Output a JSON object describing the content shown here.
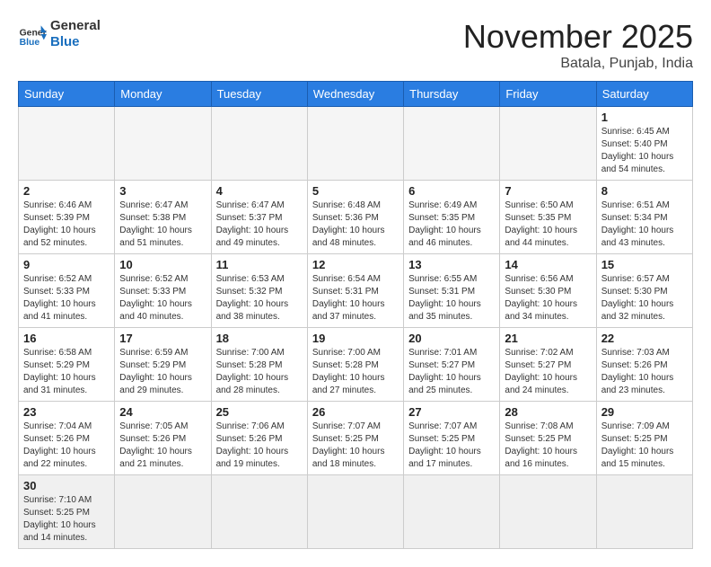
{
  "header": {
    "logo_general": "General",
    "logo_blue": "Blue",
    "month_title": "November 2025",
    "location": "Batala, Punjab, India"
  },
  "weekdays": [
    "Sunday",
    "Monday",
    "Tuesday",
    "Wednesday",
    "Thursday",
    "Friday",
    "Saturday"
  ],
  "weeks": [
    [
      {
        "day": "",
        "info": ""
      },
      {
        "day": "",
        "info": ""
      },
      {
        "day": "",
        "info": ""
      },
      {
        "day": "",
        "info": ""
      },
      {
        "day": "",
        "info": ""
      },
      {
        "day": "",
        "info": ""
      },
      {
        "day": "1",
        "info": "Sunrise: 6:45 AM\nSunset: 5:40 PM\nDaylight: 10 hours\nand 54 minutes."
      }
    ],
    [
      {
        "day": "2",
        "info": "Sunrise: 6:46 AM\nSunset: 5:39 PM\nDaylight: 10 hours\nand 52 minutes."
      },
      {
        "day": "3",
        "info": "Sunrise: 6:47 AM\nSunset: 5:38 PM\nDaylight: 10 hours\nand 51 minutes."
      },
      {
        "day": "4",
        "info": "Sunrise: 6:47 AM\nSunset: 5:37 PM\nDaylight: 10 hours\nand 49 minutes."
      },
      {
        "day": "5",
        "info": "Sunrise: 6:48 AM\nSunset: 5:36 PM\nDaylight: 10 hours\nand 48 minutes."
      },
      {
        "day": "6",
        "info": "Sunrise: 6:49 AM\nSunset: 5:35 PM\nDaylight: 10 hours\nand 46 minutes."
      },
      {
        "day": "7",
        "info": "Sunrise: 6:50 AM\nSunset: 5:35 PM\nDaylight: 10 hours\nand 44 minutes."
      },
      {
        "day": "8",
        "info": "Sunrise: 6:51 AM\nSunset: 5:34 PM\nDaylight: 10 hours\nand 43 minutes."
      }
    ],
    [
      {
        "day": "9",
        "info": "Sunrise: 6:52 AM\nSunset: 5:33 PM\nDaylight: 10 hours\nand 41 minutes."
      },
      {
        "day": "10",
        "info": "Sunrise: 6:52 AM\nSunset: 5:33 PM\nDaylight: 10 hours\nand 40 minutes."
      },
      {
        "day": "11",
        "info": "Sunrise: 6:53 AM\nSunset: 5:32 PM\nDaylight: 10 hours\nand 38 minutes."
      },
      {
        "day": "12",
        "info": "Sunrise: 6:54 AM\nSunset: 5:31 PM\nDaylight: 10 hours\nand 37 minutes."
      },
      {
        "day": "13",
        "info": "Sunrise: 6:55 AM\nSunset: 5:31 PM\nDaylight: 10 hours\nand 35 minutes."
      },
      {
        "day": "14",
        "info": "Sunrise: 6:56 AM\nSunset: 5:30 PM\nDaylight: 10 hours\nand 34 minutes."
      },
      {
        "day": "15",
        "info": "Sunrise: 6:57 AM\nSunset: 5:30 PM\nDaylight: 10 hours\nand 32 minutes."
      }
    ],
    [
      {
        "day": "16",
        "info": "Sunrise: 6:58 AM\nSunset: 5:29 PM\nDaylight: 10 hours\nand 31 minutes."
      },
      {
        "day": "17",
        "info": "Sunrise: 6:59 AM\nSunset: 5:29 PM\nDaylight: 10 hours\nand 29 minutes."
      },
      {
        "day": "18",
        "info": "Sunrise: 7:00 AM\nSunset: 5:28 PM\nDaylight: 10 hours\nand 28 minutes."
      },
      {
        "day": "19",
        "info": "Sunrise: 7:00 AM\nSunset: 5:28 PM\nDaylight: 10 hours\nand 27 minutes."
      },
      {
        "day": "20",
        "info": "Sunrise: 7:01 AM\nSunset: 5:27 PM\nDaylight: 10 hours\nand 25 minutes."
      },
      {
        "day": "21",
        "info": "Sunrise: 7:02 AM\nSunset: 5:27 PM\nDaylight: 10 hours\nand 24 minutes."
      },
      {
        "day": "22",
        "info": "Sunrise: 7:03 AM\nSunset: 5:26 PM\nDaylight: 10 hours\nand 23 minutes."
      }
    ],
    [
      {
        "day": "23",
        "info": "Sunrise: 7:04 AM\nSunset: 5:26 PM\nDaylight: 10 hours\nand 22 minutes."
      },
      {
        "day": "24",
        "info": "Sunrise: 7:05 AM\nSunset: 5:26 PM\nDaylight: 10 hours\nand 21 minutes."
      },
      {
        "day": "25",
        "info": "Sunrise: 7:06 AM\nSunset: 5:26 PM\nDaylight: 10 hours\nand 19 minutes."
      },
      {
        "day": "26",
        "info": "Sunrise: 7:07 AM\nSunset: 5:25 PM\nDaylight: 10 hours\nand 18 minutes."
      },
      {
        "day": "27",
        "info": "Sunrise: 7:07 AM\nSunset: 5:25 PM\nDaylight: 10 hours\nand 17 minutes."
      },
      {
        "day": "28",
        "info": "Sunrise: 7:08 AM\nSunset: 5:25 PM\nDaylight: 10 hours\nand 16 minutes."
      },
      {
        "day": "29",
        "info": "Sunrise: 7:09 AM\nSunset: 5:25 PM\nDaylight: 10 hours\nand 15 minutes."
      }
    ],
    [
      {
        "day": "30",
        "info": "Sunrise: 7:10 AM\nSunset: 5:25 PM\nDaylight: 10 hours\nand 14 minutes."
      },
      {
        "day": "",
        "info": ""
      },
      {
        "day": "",
        "info": ""
      },
      {
        "day": "",
        "info": ""
      },
      {
        "day": "",
        "info": ""
      },
      {
        "day": "",
        "info": ""
      },
      {
        "day": "",
        "info": ""
      }
    ]
  ]
}
